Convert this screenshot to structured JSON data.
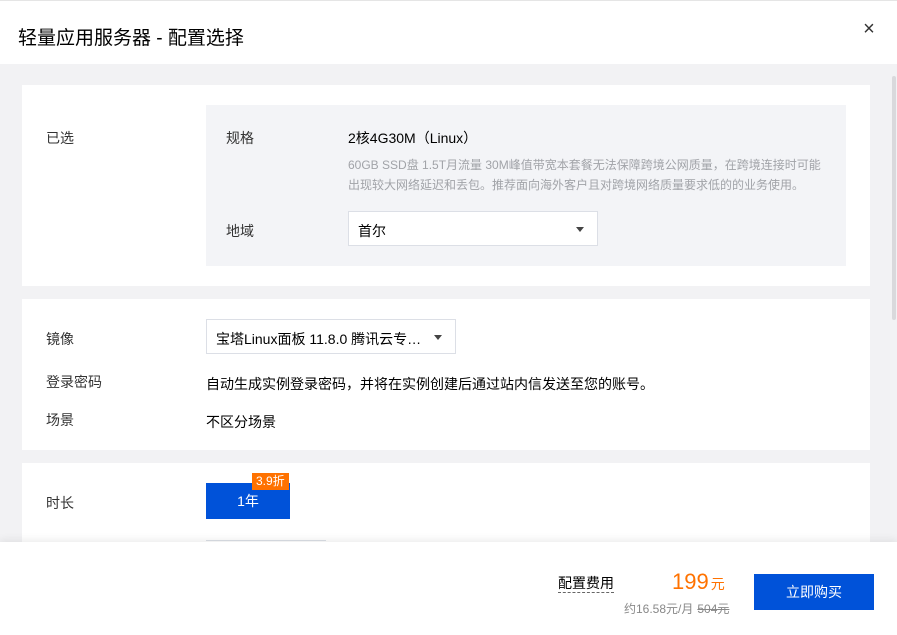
{
  "header": {
    "title": "轻量应用服务器 - 配置选择",
    "close_symbol": "×"
  },
  "selected": {
    "section_label": "已选",
    "spec_label": "规格",
    "spec_value": "2核4G30M（Linux）",
    "spec_desc": "60GB SSD盘 1.5T月流量 30M峰值带宽本套餐无法保障跨境公网质量，在跨境连接时可能出现较大网络延迟和丢包。推荐面向海外客户且对跨境网络质量要求低的的业务使用。",
    "region_label": "地域",
    "region_value": "首尔"
  },
  "image": {
    "label": "镜像",
    "value": "宝塔Linux面板 11.8.0 腾讯云专…",
    "password_label": "登录密码",
    "password_text": "自动生成实例登录密码，并将在实例创建后通过站内信发送至您的账号。",
    "scene_label": "场景",
    "scene_value": "不区分场景"
  },
  "duration": {
    "label": "时长",
    "option": "1年",
    "discount": "3.9折"
  },
  "footer": {
    "fee_label": "配置费用",
    "price": "199",
    "price_unit": "元",
    "monthly": "约16.58元/月",
    "original": "504元",
    "buy_label": "立即购买"
  },
  "colors": {
    "primary": "#0052d9",
    "accent": "#ff7200"
  },
  "icons": {
    "close": "close-icon",
    "dropdown": "chevron-down-icon"
  }
}
